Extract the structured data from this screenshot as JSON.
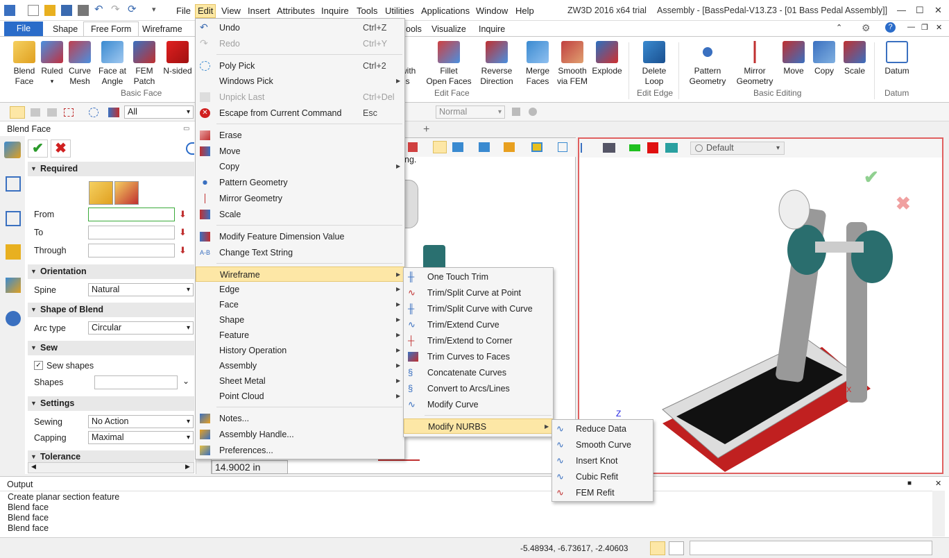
{
  "app": {
    "name": "ZW3D 2016  x64 trial",
    "doc_title": "Assembly - [BassPedal-V13.Z3 - [01 Bass Pedal Assembly]]"
  },
  "menubar": [
    "File",
    "Edit",
    "View",
    "Insert",
    "Attributes",
    "Inquire",
    "Tools",
    "Utilities",
    "Applications",
    "Window",
    "Help"
  ],
  "ribbon_tabs": [
    "File",
    "Shape",
    "Free Form",
    "Wireframe",
    "ools",
    "Visualize",
    "Inquire"
  ],
  "ribbon": {
    "basic_face": {
      "group": "Basic Face",
      "buttons": [
        {
          "label": "Blend\nFace",
          "color": "#e8b020"
        },
        {
          "label": "Ruled",
          "color": "#c03040"
        },
        {
          "label": "Curve\nMesh",
          "color": "#c04050"
        },
        {
          "label": "Face at\nAngle",
          "color": "#3a8ad0"
        },
        {
          "label": "FEM\nPatch",
          "color": "#3a70c0"
        },
        {
          "label": "N-sided",
          "color": "#d02020"
        }
      ]
    },
    "edit_face": {
      "group": "Edit Face",
      "buttons": [
        {
          "label": "with\nes",
          "color": "#3a7ac0"
        },
        {
          "label": "Fillet\nOpen Faces",
          "color": "#d04040"
        },
        {
          "label": "Reverse\nDirection",
          "color": "#c03030"
        },
        {
          "label": "Merge\nFaces",
          "color": "#3a8ad0"
        },
        {
          "label": "Smooth\nvia FEM",
          "color": "#c04040"
        },
        {
          "label": "Explode",
          "color": "#2a70c0"
        }
      ]
    },
    "edit_edge": {
      "group": "Edit Edge",
      "buttons": [
        {
          "label": "Delete\nLoop",
          "color": "#3a8ad0"
        }
      ]
    },
    "basic_editing": {
      "group": "Basic Editing",
      "buttons": [
        {
          "label": "Pattern\nGeometry",
          "color": "#3a70c0"
        },
        {
          "label": "Mirror\nGeometry",
          "color": "#c03030"
        },
        {
          "label": "Move",
          "color": "#3a70c0"
        },
        {
          "label": "Copy",
          "color": "#3a70c0"
        },
        {
          "label": "Scale",
          "color": "#c03030"
        }
      ]
    },
    "datum": {
      "group": "Datum",
      "buttons": [
        {
          "label": "Datum",
          "color": "#3a70c0"
        }
      ]
    }
  },
  "filter": {
    "value": "All"
  },
  "render_mode": "Normal",
  "view_style": "Default",
  "left_panel": {
    "title": "Blend Face",
    "required": "Required",
    "from": "From",
    "to": "To",
    "through": "Through",
    "orientation": "Orientation",
    "spine_label": "Spine",
    "spine_value": "Natural",
    "shape_of_blend": "Shape of Blend",
    "arc_type_label": "Arc type",
    "arc_type_value": "Circular",
    "sew": "Sew",
    "sew_shapes": "Sew shapes",
    "shapes_label": "Shapes",
    "settings": "Settings",
    "sewing_label": "Sewing",
    "sewing_value": "No Action",
    "capping_label": "Capping",
    "capping_value": "Maximal",
    "tolerance": "Tolerance"
  },
  "viewport": {
    "hint": "ng.",
    "dimension": "14.9002 in",
    "axis_z": "Z",
    "axis_x": "X"
  },
  "edit_menu": [
    {
      "label": "Undo",
      "shortcut": "Ctrl+Z"
    },
    {
      "label": "Redo",
      "shortcut": "Ctrl+Y",
      "disabled": true
    },
    {
      "label": "Poly Pick",
      "shortcut": "Ctrl+2"
    },
    {
      "label": "Windows Pick",
      "submenu": true
    },
    {
      "label": "Unpick Last",
      "shortcut": "Ctrl+Del",
      "disabled": true
    },
    {
      "label": "Escape from Current Command",
      "shortcut": "Esc"
    },
    {
      "label": "Erase"
    },
    {
      "label": "Move"
    },
    {
      "label": "Copy",
      "submenu": true
    },
    {
      "label": "Pattern Geometry"
    },
    {
      "label": "Mirror Geometry"
    },
    {
      "label": "Scale"
    },
    {
      "label": "Modify Feature Dimension Value"
    },
    {
      "label": "Change Text String"
    },
    {
      "label": "Wireframe",
      "submenu": true
    },
    {
      "label": "Edge",
      "submenu": true
    },
    {
      "label": "Face",
      "submenu": true
    },
    {
      "label": "Shape",
      "submenu": true
    },
    {
      "label": "Feature",
      "submenu": true
    },
    {
      "label": "History Operation",
      "submenu": true
    },
    {
      "label": "Assembly",
      "submenu": true
    },
    {
      "label": "Sheet Metal",
      "submenu": true
    },
    {
      "label": "Point Cloud",
      "submenu": true
    },
    {
      "label": "Notes..."
    },
    {
      "label": "Assembly Handle..."
    },
    {
      "label": "Preferences..."
    }
  ],
  "wireframe_menu": [
    {
      "label": "One Touch Trim"
    },
    {
      "label": "Trim/Split Curve at Point"
    },
    {
      "label": "Trim/Split Curve with Curve"
    },
    {
      "label": "Trim/Extend Curve"
    },
    {
      "label": "Trim/Extend to Corner"
    },
    {
      "label": "Trim Curves to Faces"
    },
    {
      "label": "Concatenate Curves"
    },
    {
      "label": "Convert to Arcs/Lines"
    },
    {
      "label": "Modify Curve"
    },
    {
      "label": "Modify NURBS"
    }
  ],
  "nurbs_menu": [
    {
      "label": "Reduce Data"
    },
    {
      "label": "Smooth Curve"
    },
    {
      "label": "Insert Knot"
    },
    {
      "label": "Cubic Refit"
    },
    {
      "label": "FEM Refit"
    }
  ],
  "output": {
    "title": "Output",
    "lines": [
      "Create planar section feature",
      "Blend face",
      "Blend face",
      "Blend face"
    ]
  },
  "status": {
    "coords": "-5.48934, -6.73617, -2.40603"
  },
  "colors": {
    "accent": "#2b6cc9",
    "highlight": "#fde7a6",
    "pedal": "#2a6e6e",
    "red": "#c02020"
  }
}
